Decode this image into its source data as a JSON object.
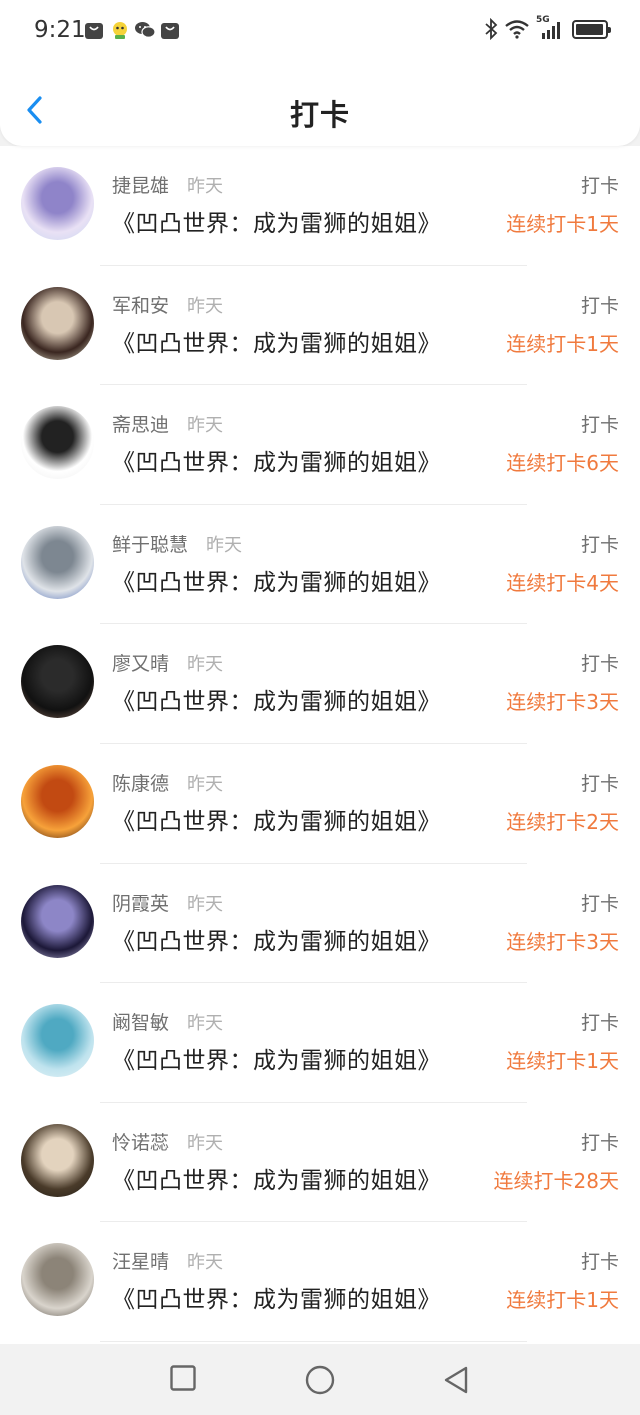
{
  "status_bar": {
    "time": "9:21",
    "network": "5G"
  },
  "header": {
    "title": "打卡"
  },
  "checkins": [
    {
      "name": "捷昆雄",
      "time_ago": "昨天",
      "book": "《凹凸世界：成为雷狮的姐姐》",
      "action": "打卡",
      "streak": "连续打卡1天",
      "avatar_colors": [
        "#e9e1f5",
        "#8f84c9",
        "#c6d4ef"
      ]
    },
    {
      "name": "军和安",
      "time_ago": "昨天",
      "book": "《凹凸世界：成为雷狮的姐姐》",
      "action": "打卡",
      "streak": "连续打卡1天",
      "avatar_colors": [
        "#3a2620",
        "#d8c7b3",
        "#e8e6cf"
      ]
    },
    {
      "name": "斋思迪",
      "time_ago": "昨天",
      "book": "《凹凸世界：成为雷狮的姐姐》",
      "action": "打卡",
      "streak": "连续打卡6天",
      "avatar_colors": [
        "#ffffff",
        "#222222",
        "#ececec"
      ]
    },
    {
      "name": "鲜于聪慧",
      "time_ago": "昨天",
      "book": "《凹凸世界：成为雷狮的姐姐》",
      "action": "打卡",
      "streak": "连续打卡4天",
      "avatar_colors": [
        "#dfe3e8",
        "#7d8791",
        "#3d5fb0"
      ]
    },
    {
      "name": "廖又晴",
      "time_ago": "昨天",
      "book": "《凹凸世界：成为雷狮的姐姐》",
      "action": "打卡",
      "streak": "连续打卡3天",
      "avatar_colors": [
        "#111111",
        "#2b2b2b",
        "#8a6a5a"
      ]
    },
    {
      "name": "陈康德",
      "time_ago": "昨天",
      "book": "《凹凸世界：成为雷狮的姐姐》",
      "action": "打卡",
      "streak": "连续打卡2天",
      "avatar_colors": [
        "#f7a23a",
        "#c24a12",
        "#2a0a04"
      ]
    },
    {
      "name": "阴霞英",
      "time_ago": "昨天",
      "book": "《凹凸世界：成为雷狮的姐姐》",
      "action": "打卡",
      "streak": "连续打卡3天",
      "avatar_colors": [
        "#1c1838",
        "#8d86c7",
        "#c9c4ea"
      ]
    },
    {
      "name": "阚智敏",
      "time_ago": "昨天",
      "book": "《凹凸世界：成为雷狮的姐姐》",
      "action": "打卡",
      "streak": "连续打卡1天",
      "avatar_colors": [
        "#bfe3ee",
        "#4fa9c2",
        "#e8f4f7"
      ]
    },
    {
      "name": "怜诺蕊",
      "time_ago": "昨天",
      "book": "《凹凸世界：成为雷狮的姐姐》",
      "action": "打卡",
      "streak": "连续打卡28天",
      "avatar_colors": [
        "#4a3b2a",
        "#e3d3be",
        "#1f1a14"
      ]
    },
    {
      "name": "汪星晴",
      "time_ago": "昨天",
      "book": "《凹凸世界：成为雷狮的姐姐》",
      "action": "打卡",
      "streak": "连续打卡1天",
      "avatar_colors": [
        "#d9d4cc",
        "#8c8478",
        "#4a433a"
      ]
    }
  ],
  "colors": {
    "accent_blue": "#1a8ef1",
    "streak_orange": "#f07a3e",
    "muted_text": "#707070"
  }
}
